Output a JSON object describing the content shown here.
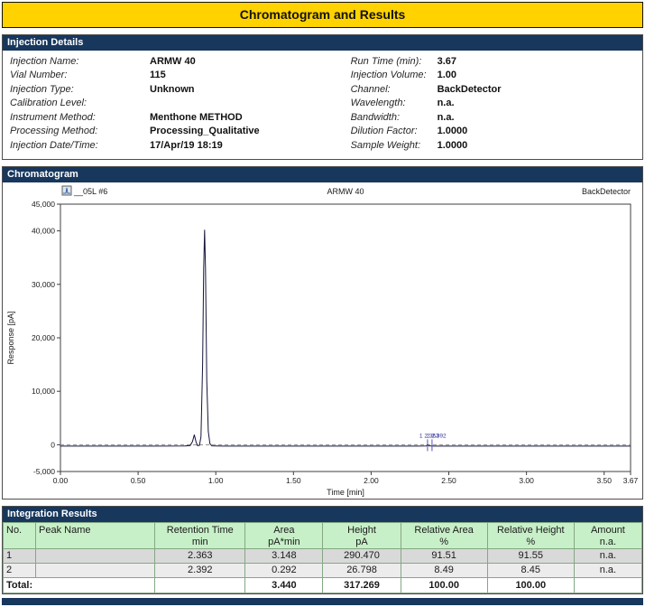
{
  "colors": {
    "title_bg": "#FFD200",
    "section_header_bg": "#17375D",
    "table_header_bg": "#C8F0C8"
  },
  "title": "Chromatogram and Results",
  "injection": {
    "header": "Injection Details",
    "left": [
      {
        "label": "Injection Name:",
        "value": "ARMW 40"
      },
      {
        "label": "Vial Number:",
        "value": "115"
      },
      {
        "label": "Injection Type:",
        "value": "Unknown"
      },
      {
        "label": "Calibration Level:",
        "value": ""
      },
      {
        "label": "Instrument Method:",
        "value": "Menthone METHOD"
      },
      {
        "label": "Processing Method:",
        "value": "Processing_Qualitative"
      },
      {
        "label": "Injection Date/Time:",
        "value": "17/Apr/19 18:19"
      }
    ],
    "right": [
      {
        "label": "Run Time (min):",
        "value": "3.67"
      },
      {
        "label": "Injection Volume:",
        "value": "1.00"
      },
      {
        "label": "Channel:",
        "value": "BackDetector"
      },
      {
        "label": "Wavelength:",
        "value": "n.a."
      },
      {
        "label": "Bandwidth:",
        "value": "n.a."
      },
      {
        "label": "Dilution Factor:",
        "value": "1.0000"
      },
      {
        "label": "Sample Weight:",
        "value": "1.0000"
      }
    ]
  },
  "chromatogram_section": {
    "header": "Chromatogram"
  },
  "chart_data": {
    "type": "line",
    "series_label": "__05L #6",
    "title": "ARMW 40",
    "detector_label": "BackDetector",
    "xlabel": "Time [min]",
    "ylabel": "Response [pA]",
    "xlim": [
      0,
      3.67
    ],
    "ylim": [
      -5000,
      45000
    ],
    "xticks": [
      0,
      0.5,
      1,
      1.5,
      2,
      2.5,
      3,
      3.5,
      3.67
    ],
    "yticks": [
      -5000,
      0,
      10000,
      20000,
      30000,
      40000,
      45000
    ],
    "baseline": {
      "y": 0,
      "style": "dashed"
    },
    "trace": [
      [
        0,
        -250
      ],
      [
        0.6,
        -250
      ],
      [
        0.8,
        -240
      ],
      [
        0.835,
        -150
      ],
      [
        0.85,
        600
      ],
      [
        0.862,
        1900
      ],
      [
        0.872,
        600
      ],
      [
        0.882,
        -150
      ],
      [
        0.895,
        -100
      ],
      [
        0.905,
        1500
      ],
      [
        0.915,
        15000
      ],
      [
        0.922,
        33000
      ],
      [
        0.928,
        40200
      ],
      [
        0.934,
        33000
      ],
      [
        0.942,
        12000
      ],
      [
        0.952,
        2500
      ],
      [
        0.962,
        200
      ],
      [
        0.975,
        -200
      ],
      [
        1.05,
        -250
      ],
      [
        2.3,
        -250
      ],
      [
        2.355,
        -240
      ],
      [
        2.363,
        40
      ],
      [
        2.372,
        -200
      ],
      [
        2.385,
        -230
      ],
      [
        2.392,
        -225
      ],
      [
        2.405,
        -245
      ],
      [
        3.0,
        -250
      ],
      [
        3.67,
        -250
      ]
    ],
    "integrated_peaks": [
      {
        "no": "1",
        "retention_time": 2.363,
        "height": 290.47
      },
      {
        "no": "2",
        "retention_time": 2.392,
        "height": 26.798
      }
    ]
  },
  "integration": {
    "header": "Integration Results",
    "columns": [
      {
        "name": "No.",
        "unit": ""
      },
      {
        "name": "Peak Name",
        "unit": ""
      },
      {
        "name": "Retention Time",
        "unit": "min"
      },
      {
        "name": "Area",
        "unit": "pA*min"
      },
      {
        "name": "Height",
        "unit": "pA"
      },
      {
        "name": "Relative Area",
        "unit": "%"
      },
      {
        "name": "Relative Height",
        "unit": "%"
      },
      {
        "name": "Amount",
        "unit": "n.a."
      }
    ],
    "rows": [
      {
        "no": "1",
        "peak_name": "",
        "retention_time": "2.363",
        "area": "3.148",
        "height": "290.470",
        "relative_area": "91.51",
        "relative_height": "91.55",
        "amount": "n.a."
      },
      {
        "no": "2",
        "peak_name": "",
        "retention_time": "2.392",
        "area": "0.292",
        "height": "26.798",
        "relative_area": "8.49",
        "relative_height": "8.45",
        "amount": "n.a."
      }
    ],
    "total": {
      "label": "Total:",
      "area": "3.440",
      "height": "317.269",
      "relative_area": "100.00",
      "relative_height": "100.00"
    }
  }
}
